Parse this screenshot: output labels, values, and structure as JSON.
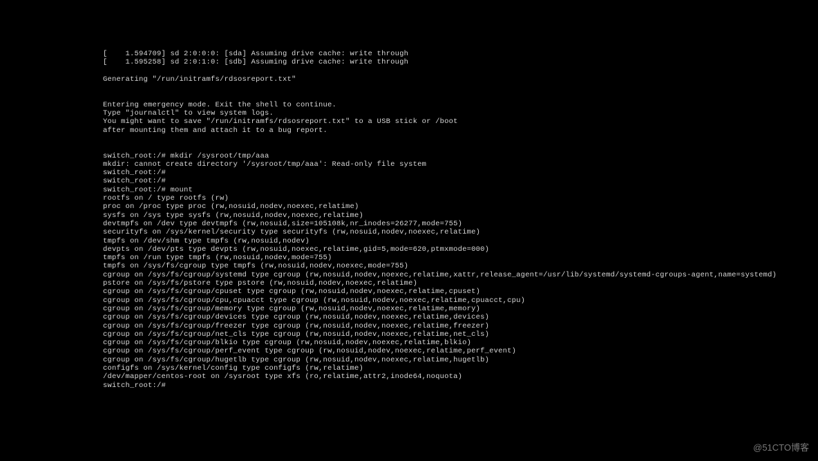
{
  "watermark": "@51CTO博客",
  "prompt": "switch_root:/#",
  "lines": [
    "[    1.594709] sd 2:0:0:0: [sda] Assuming drive cache: write through",
    "[    1.595258] sd 2:0:1:0: [sdb] Assuming drive cache: write through",
    "",
    "Generating \"/run/initramfs/rdsosreport.txt\"",
    "",
    "",
    "Entering emergency mode. Exit the shell to continue.",
    "Type \"journalctl\" to view system logs.",
    "You might want to save \"/run/initramfs/rdsosreport.txt\" to a USB stick or /boot",
    "after mounting them and attach it to a bug report.",
    "",
    "",
    "switch_root:/# mkdir /sysroot/tmp/aaa",
    "mkdir: cannot create directory '/sysroot/tmp/aaa': Read-only file system",
    "switch_root:/#",
    "switch_root:/#",
    "switch_root:/# mount",
    "rootfs on / type rootfs (rw)",
    "proc on /proc type proc (rw,nosuid,nodev,noexec,relatime)",
    "sysfs on /sys type sysfs (rw,nosuid,nodev,noexec,relatime)",
    "devtmpfs on /dev type devtmpfs (rw,nosuid,size=105108k,nr_inodes=26277,mode=755)",
    "securityfs on /sys/kernel/security type securityfs (rw,nosuid,nodev,noexec,relatime)",
    "tmpfs on /dev/shm type tmpfs (rw,nosuid,nodev)",
    "devpts on /dev/pts type devpts (rw,nosuid,noexec,relatime,gid=5,mode=620,ptmxmode=000)",
    "tmpfs on /run type tmpfs (rw,nosuid,nodev,mode=755)",
    "tmpfs on /sys/fs/cgroup type tmpfs (rw,nosuid,nodev,noexec,mode=755)",
    "cgroup on /sys/fs/cgroup/systemd type cgroup (rw,nosuid,nodev,noexec,relatime,xattr,release_agent=/usr/lib/systemd/systemd-cgroups-agent,name=systemd)",
    "pstore on /sys/fs/pstore type pstore (rw,nosuid,nodev,noexec,relatime)",
    "cgroup on /sys/fs/cgroup/cpuset type cgroup (rw,nosuid,nodev,noexec,relatime,cpuset)",
    "cgroup on /sys/fs/cgroup/cpu,cpuacct type cgroup (rw,nosuid,nodev,noexec,relatime,cpuacct,cpu)",
    "cgroup on /sys/fs/cgroup/memory type cgroup (rw,nosuid,nodev,noexec,relatime,memory)",
    "cgroup on /sys/fs/cgroup/devices type cgroup (rw,nosuid,nodev,noexec,relatime,devices)",
    "cgroup on /sys/fs/cgroup/freezer type cgroup (rw,nosuid,nodev,noexec,relatime,freezer)",
    "cgroup on /sys/fs/cgroup/net_cls type cgroup (rw,nosuid,nodev,noexec,relatime,net_cls)",
    "cgroup on /sys/fs/cgroup/blkio type cgroup (rw,nosuid,nodev,noexec,relatime,blkio)",
    "cgroup on /sys/fs/cgroup/perf_event type cgroup (rw,nosuid,nodev,noexec,relatime,perf_event)",
    "cgroup on /sys/fs/cgroup/hugetlb type cgroup (rw,nosuid,nodev,noexec,relatime,hugetlb)",
    "configfs on /sys/kernel/config type configfs (rw,relatime)",
    "/dev/mapper/centos-root on /sysroot type xfs (ro,relatime,attr2,inode64,noquota)",
    "switch_root:/#"
  ]
}
